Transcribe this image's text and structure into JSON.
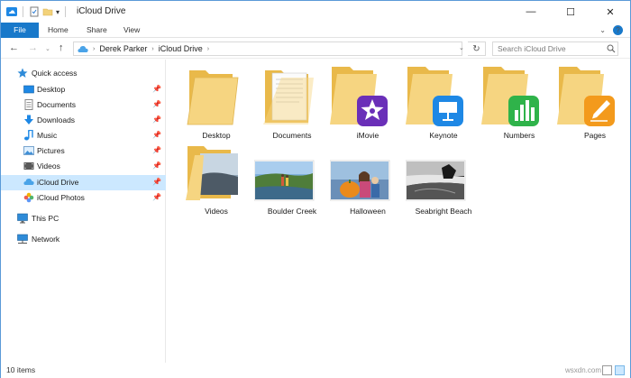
{
  "window": {
    "title": "iCloud Drive",
    "controls": {
      "minimize": "—",
      "maximize": "☐",
      "close": "✕"
    },
    "qat_dropdown": "▾"
  },
  "ribbon": {
    "tabs": [
      "File",
      "Home",
      "Share",
      "View"
    ],
    "expand_glyph": "⌄",
    "help_glyph": "?"
  },
  "nav": {
    "back": "←",
    "forward": "→",
    "recent": "⌄",
    "up": "↑",
    "breadcrumb_sep": "›",
    "breadcrumb": [
      "Derek Parker",
      "iCloud Drive"
    ],
    "address_dropdown": "⌄",
    "refresh": "↻",
    "search_placeholder": "Search iCloud Drive"
  },
  "sidebar": {
    "pin_glyph": "📌",
    "items": [
      {
        "label": "Quick access",
        "icon": "star-icon"
      },
      {
        "label": "Desktop",
        "icon": "desktop-icon",
        "pinned": true
      },
      {
        "label": "Documents",
        "icon": "documents-icon",
        "pinned": true
      },
      {
        "label": "Downloads",
        "icon": "downloads-icon",
        "pinned": true
      },
      {
        "label": "Music",
        "icon": "music-icon",
        "pinned": true
      },
      {
        "label": "Pictures",
        "icon": "pictures-icon",
        "pinned": true
      },
      {
        "label": "Videos",
        "icon": "videos-icon",
        "pinned": true
      },
      {
        "label": "iCloud Drive",
        "icon": "icloud-drive-icon",
        "pinned": true,
        "selected": true
      },
      {
        "label": "iCloud Photos",
        "icon": "icloud-photos-icon",
        "pinned": true
      },
      {
        "label": "This PC",
        "icon": "this-pc-icon"
      },
      {
        "label": "Network",
        "icon": "network-icon"
      }
    ]
  },
  "items": [
    {
      "label": "Desktop",
      "kind": "folder"
    },
    {
      "label": "Documents",
      "kind": "folder-docs"
    },
    {
      "label": "iMovie",
      "kind": "app-imovie"
    },
    {
      "label": "Keynote",
      "kind": "app-keynote"
    },
    {
      "label": "Numbers",
      "kind": "app-numbers"
    },
    {
      "label": "Pages",
      "kind": "app-pages"
    },
    {
      "label": "Videos",
      "kind": "folder-videos"
    },
    {
      "label": "Boulder Creek",
      "kind": "photo-boulder"
    },
    {
      "label": "Halloween",
      "kind": "photo-halloween"
    },
    {
      "label": "Seabright Beach",
      "kind": "photo-seabright"
    }
  ],
  "colors": {
    "accent": "#1979ca",
    "selection": "#cce8ff",
    "folder": "#f3d27a",
    "imovie": "#6a2fb8",
    "keynote": "#1e88e5",
    "numbers": "#2fb34a",
    "pages": "#f39a1c"
  },
  "status": {
    "item_count": "10 items",
    "watermark": "wsxdn.com"
  }
}
